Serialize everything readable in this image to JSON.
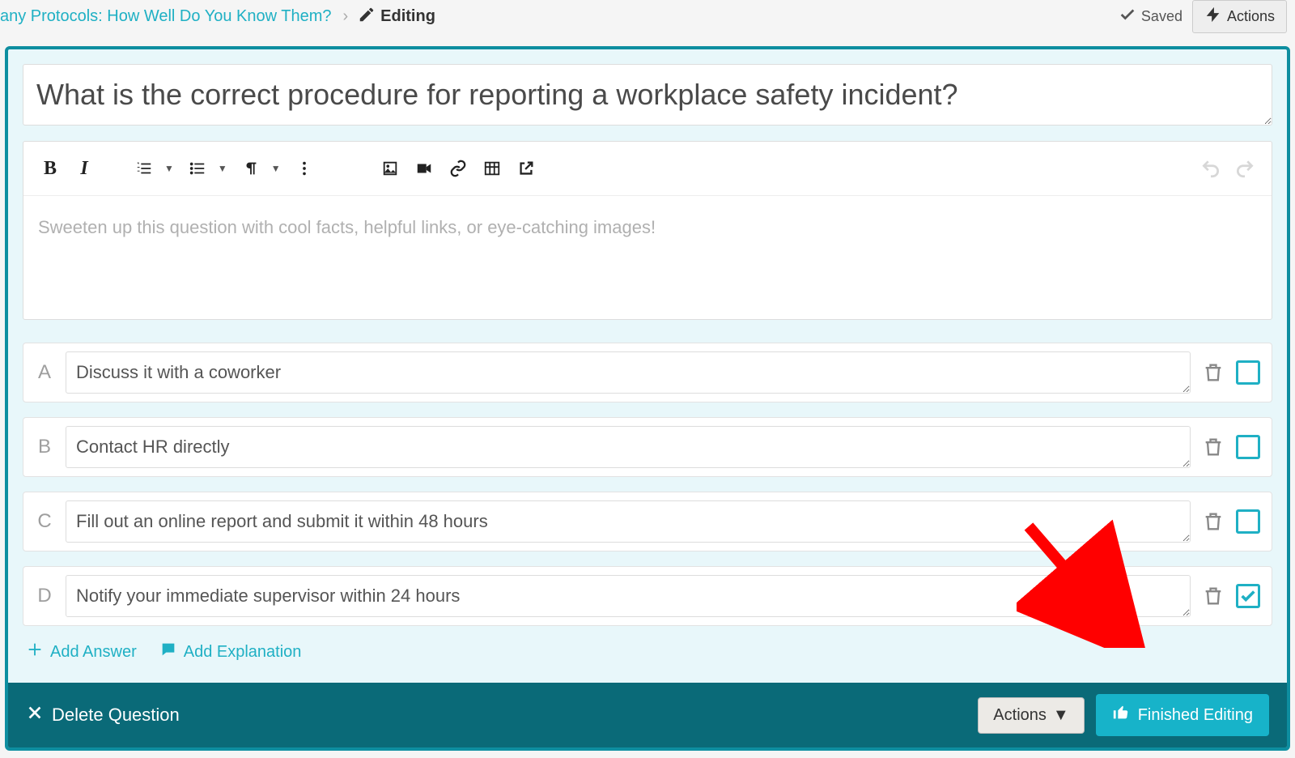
{
  "breadcrumb": {
    "parent": "any Protocols: How Well Do You Know Them?",
    "current": "Editing"
  },
  "top": {
    "saved": "Saved",
    "actions": "Actions"
  },
  "question": {
    "text": "What is the correct procedure for reporting a workplace safety incident?",
    "editor_placeholder": "Sweeten up this question with cool facts, helpful links, or eye-catching images!"
  },
  "answers": [
    {
      "label": "A",
      "text": "Discuss it with a coworker",
      "correct": false
    },
    {
      "label": "B",
      "text": "Contact HR directly",
      "correct": false
    },
    {
      "label": "C",
      "text": "Fill out an online report and submit it within 48 hours",
      "correct": false
    },
    {
      "label": "D",
      "text": "Notify your immediate supervisor within 24 hours",
      "correct": true
    }
  ],
  "links": {
    "add_answer": "Add Answer",
    "add_explanation": "Add Explanation"
  },
  "footer": {
    "delete": "Delete Question",
    "actions": "Actions",
    "finish": "Finished Editing"
  }
}
